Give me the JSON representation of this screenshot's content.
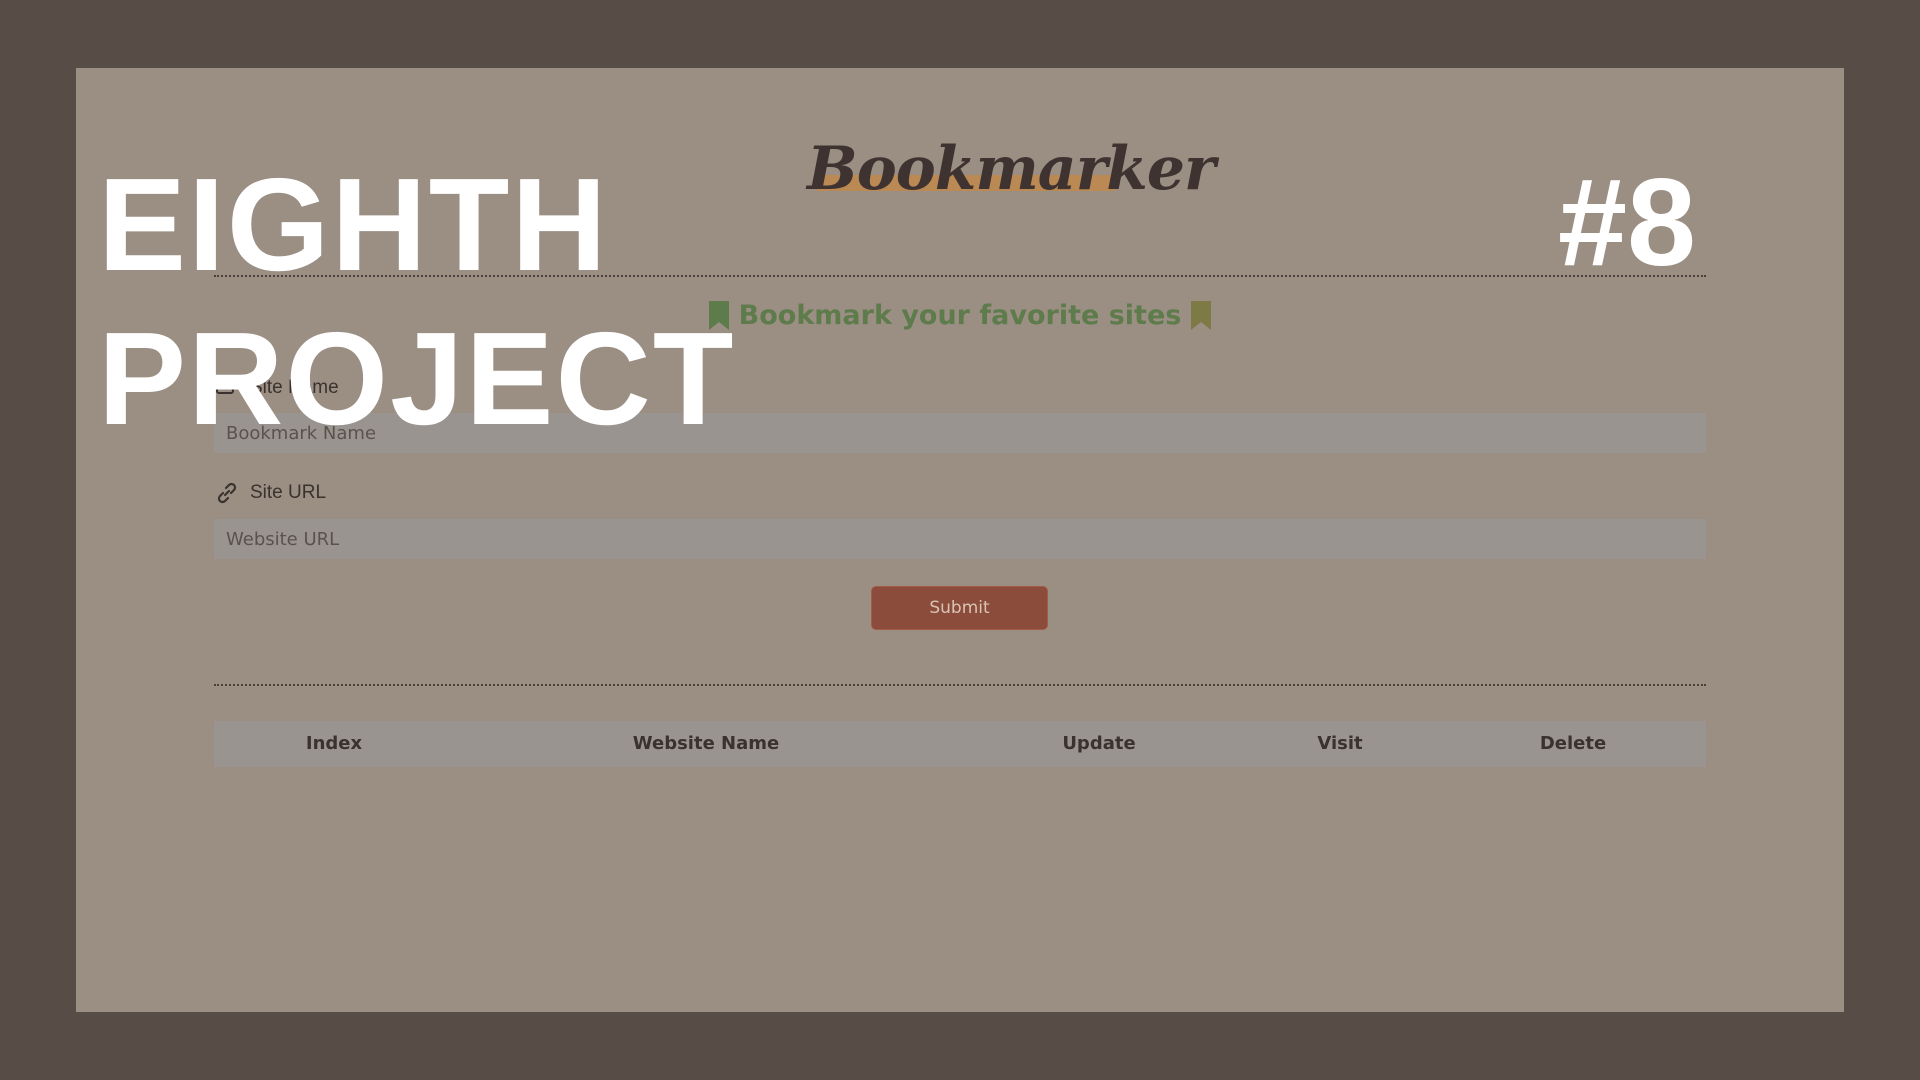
{
  "app": {
    "logo": "Bookmarker",
    "tagline": "Bookmark your favorite sites"
  },
  "form": {
    "site_name_label": "Site Name",
    "site_name_placeholder": "Bookmark Name",
    "site_url_label": "Site URL",
    "site_url_placeholder": "Website URL",
    "submit_label": "Submit"
  },
  "table": {
    "headers": [
      "Index",
      "Website Name",
      "Update",
      "Visit",
      "Delete"
    ]
  },
  "overlay": {
    "title_line1": "EIGHTH",
    "title_line2": "PROJECT",
    "number": "#8"
  },
  "colors": {
    "backdrop": "#574c46",
    "panel": "#9b8f84",
    "accent_green": "#5e7b4b",
    "accent_olive": "#7d7a46",
    "submit": "#8b4c3b",
    "logo_highlight": "#c1884a"
  },
  "icons": {
    "tagline_left": "bookmark-icon",
    "tagline_right": "bookmark-icon",
    "site_name": "card-icon",
    "site_url": "link-icon"
  }
}
